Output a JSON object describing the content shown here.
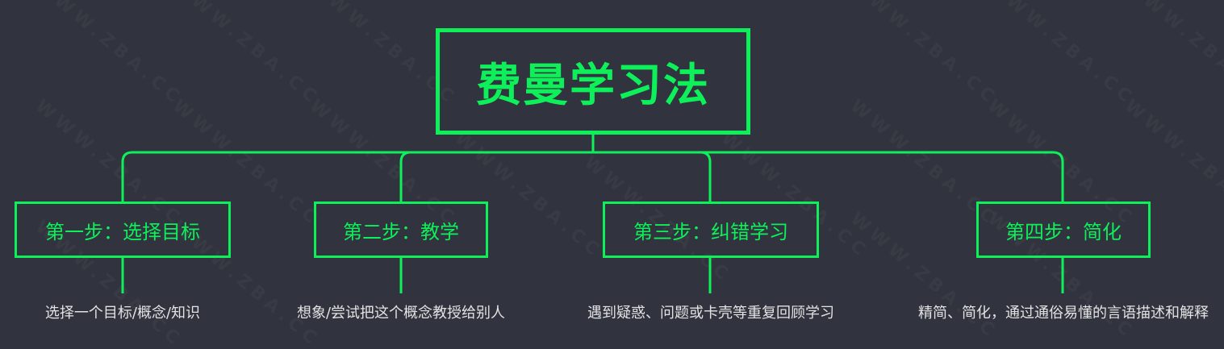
{
  "colors": {
    "accent": "#0ef05a",
    "background": "#31333e",
    "description_text": "#e3e3e3"
  },
  "root": {
    "title": "费曼学习法"
  },
  "steps": [
    {
      "label": "第一步：选择目标",
      "description": "选择一个目标/概念/知识"
    },
    {
      "label": "第二步：教学",
      "description": "想象/尝试把这个概念教授给别人"
    },
    {
      "label": "第三步：纠错学习",
      "description": "遇到疑惑、问题或卡壳等重复回顾学习"
    },
    {
      "label": "第四步：简化",
      "description": "精简、简化，通过通俗易懂的言语描述和解释"
    }
  ],
  "watermark": {
    "text": "WWW.ZBA.CC"
  }
}
